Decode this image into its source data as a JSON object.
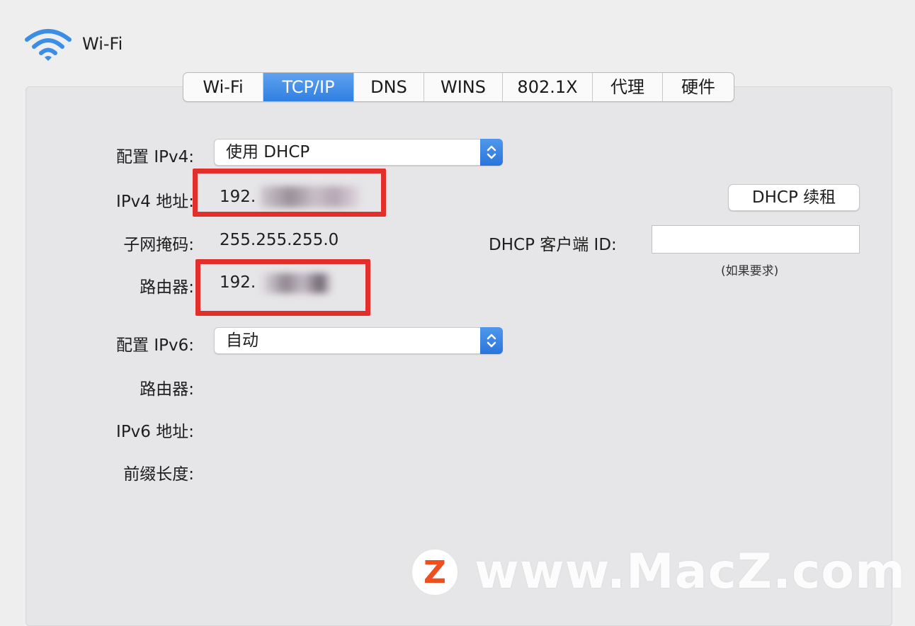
{
  "header": {
    "title": "Wi-Fi",
    "icon": "wifi-icon"
  },
  "tabs": [
    {
      "label": "Wi-Fi",
      "active": false
    },
    {
      "label": "TCP/IP",
      "active": true
    },
    {
      "label": "DNS",
      "active": false
    },
    {
      "label": "WINS",
      "active": false
    },
    {
      "label": "802.1X",
      "active": false
    },
    {
      "label": "代理",
      "active": false
    },
    {
      "label": "硬件",
      "active": false
    }
  ],
  "ipv4": {
    "config_label": "配置 IPv4:",
    "config_value": "使用 DHCP",
    "address_label": "IPv4 地址:",
    "address_value": "192.",
    "subnet_label": "子网掩码:",
    "subnet_value": "255.255.255.0",
    "router_label": "路由器:",
    "router_value": "192."
  },
  "dhcp": {
    "renew_button": "DHCP 续租",
    "client_id_label": "DHCP 客户端 ID:",
    "client_id_value": "",
    "hint": "(如果要求)"
  },
  "ipv6": {
    "config_label": "配置 IPv6:",
    "config_value": "自动",
    "router_label": "路由器:",
    "address_label": "IPv6 地址:",
    "prefix_label": "前缀长度:"
  },
  "watermark": {
    "logo_letter": "Z",
    "text": "www.MacZ.com"
  },
  "colors": {
    "accent": "#2f7fe3",
    "highlight_box": "#e22f2c",
    "watermark_logo": "#ef4f1f"
  }
}
